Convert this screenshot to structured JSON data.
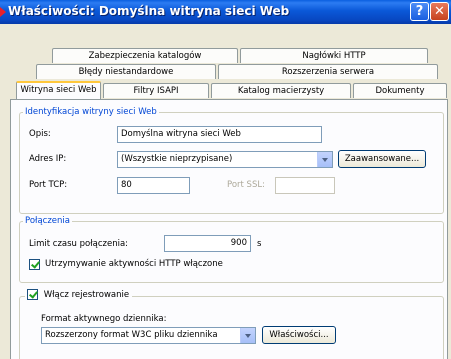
{
  "window": {
    "title": "Właściwości: Domyślna witryna sieci Web",
    "help_button": "?",
    "close_button": "✕"
  },
  "tabs": {
    "row1": [
      "Zabezpieczenia katalogów",
      "Nagłówki HTTP"
    ],
    "row2": [
      "Błędy niestandardowe",
      "Rozszerzenia serwera"
    ],
    "row3": [
      "Witryna sieci Web",
      "Filtry ISAPI",
      "Katalog macierzysty",
      "Dokumenty"
    ],
    "active": "Witryna sieci Web"
  },
  "identification": {
    "legend": "Identyfikacja witryny sieci Web",
    "description_label": "Opis:",
    "description_value": "Domyślna witryna sieci Web",
    "ip_label": "Adres IP:",
    "ip_value": "(Wszystkie nieprzypisane)",
    "advanced_button": "Zaawansowane...",
    "tcp_port_label": "Port TCP:",
    "tcp_port_value": "80",
    "ssl_port_label": "Port SSL:",
    "ssl_port_value": ""
  },
  "connections": {
    "legend": "Połączenia",
    "timeout_label": "Limit czasu połączenia:",
    "timeout_value": "900",
    "timeout_unit": "s",
    "keepalive_label": "Utrzymywanie aktywności HTTP włączone",
    "keepalive_checked": true
  },
  "logging": {
    "enable_label": "Włącz rejestrowanie",
    "enable_checked": true,
    "format_label": "Format aktywnego dziennika:",
    "format_value": "Rozszerzony format W3C pliku dziennika",
    "properties_button": "Właściwości..."
  }
}
